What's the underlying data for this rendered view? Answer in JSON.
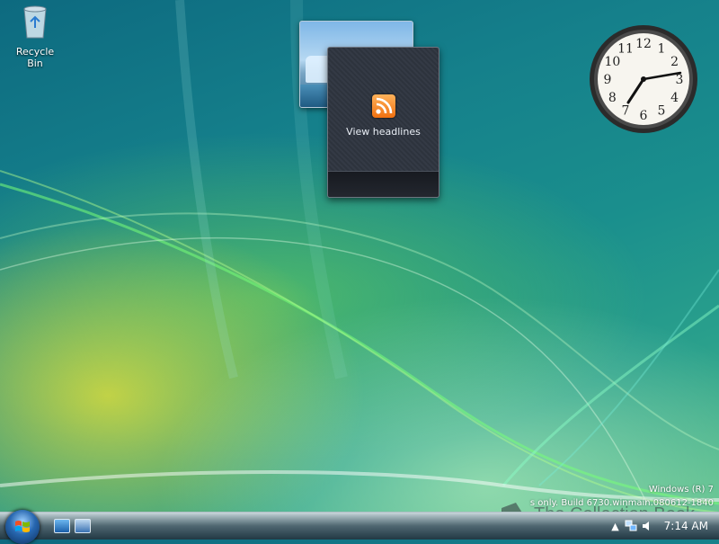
{
  "desktop": {
    "recycle_bin_label": "Recycle Bin"
  },
  "gadgets": {
    "feed": {
      "label": "View headlines",
      "icon": "rss-feed-icon"
    },
    "slideshow": {
      "icon": "slideshow-image"
    },
    "clock": {
      "numerals": [
        "12",
        "1",
        "2",
        "3",
        "4",
        "5",
        "6",
        "7",
        "8",
        "9",
        "10",
        "11"
      ],
      "time": "7:14"
    }
  },
  "watermark": {
    "line1": "Windows (R) 7",
    "line2": "s only. Build 6730.winmain.080612-1840"
  },
  "overlay": {
    "text": "The Collection Book"
  },
  "taskbar": {
    "start_icon": "windows-orb-icon",
    "quicklaunch": [
      "show-desktop-icon",
      "switch-windows-icon"
    ],
    "tray": {
      "expand_glyph": "▲",
      "icons": [
        "network-icon",
        "volume-icon"
      ],
      "time": "7:14 AM"
    }
  },
  "colors": {
    "accent": "#1a8f8d",
    "rss": "#f07010"
  }
}
